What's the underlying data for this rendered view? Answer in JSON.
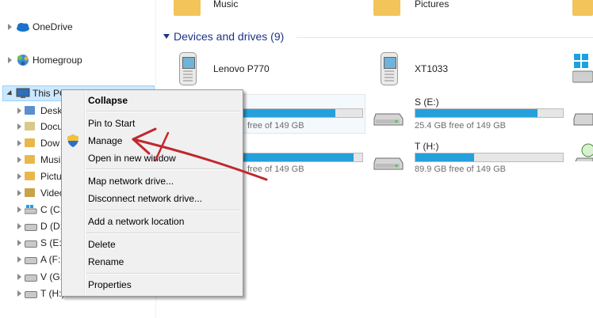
{
  "nav": {
    "onedrive": "OneDrive",
    "homegroup": "Homegroup",
    "thispc": "This PC",
    "children": [
      {
        "label": "Desk",
        "icon": "desktop-folder-icon"
      },
      {
        "label": "Docu",
        "icon": "documents-folder-icon"
      },
      {
        "label": "Dow",
        "icon": "downloads-folder-icon"
      },
      {
        "label": "Musi",
        "icon": "music-folder-icon"
      },
      {
        "label": "Pictu",
        "icon": "pictures-folder-icon"
      },
      {
        "label": "Video",
        "icon": "videos-folder-icon"
      },
      {
        "label": "C (C:",
        "icon": "windows-drive-icon"
      },
      {
        "label": "D (D:",
        "icon": "drive-icon"
      },
      {
        "label": "S (E:)",
        "icon": "drive-icon"
      },
      {
        "label": "A (F:",
        "icon": "drive-icon"
      },
      {
        "label": "V (G:",
        "icon": "drive-icon"
      },
      {
        "label": "T (H:)",
        "icon": "drive-icon"
      }
    ]
  },
  "main": {
    "folders": [
      {
        "label": "Music"
      },
      {
        "label": "Pictures"
      }
    ],
    "group_header": "Devices and drives (9)",
    "devices": [
      {
        "label": "Lenovo P770"
      },
      {
        "label": "XT1033"
      }
    ],
    "drives": [
      {
        "label": "",
        "free": "free of 149 GB",
        "fill": 0.78
      },
      {
        "label": "S (E:)",
        "free": "25.4 GB free of 149 GB",
        "fill": 0.83
      },
      {
        "label": "",
        "free": "free of 149 GB",
        "fill": 0.93
      },
      {
        "label": "T (H:)",
        "free": "89.9 GB free of 149 GB",
        "fill": 0.4
      }
    ]
  },
  "context_menu": {
    "collapse": "Collapse",
    "pin_to_start": "Pin to Start",
    "manage": "Manage",
    "open_new_window": "Open in new window",
    "map_network_drive": "Map network drive...",
    "disconnect_network_drive": "Disconnect network drive...",
    "add_network_location": "Add a network location",
    "delete": "Delete",
    "rename": "Rename",
    "properties": "Properties"
  },
  "colors": {
    "bar_fill": "#26a0da",
    "selection": "#cce8ff",
    "annotation_arrow": "#c0282d",
    "group_header": "#1e3287"
  }
}
